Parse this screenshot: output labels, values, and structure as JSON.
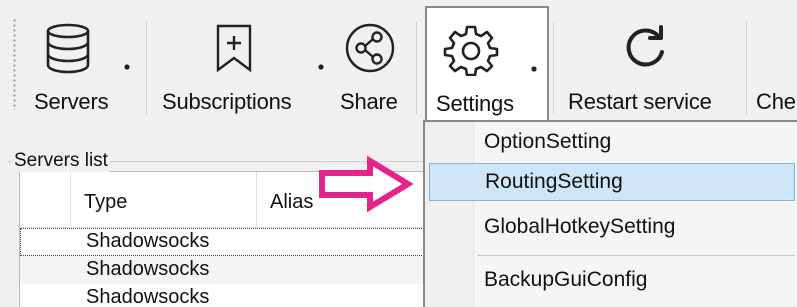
{
  "toolbar": {
    "servers_label": "Servers",
    "subscriptions_label": "Subscriptions",
    "share_label": "Share",
    "settings_label": "Settings",
    "restart_label": "Restart service",
    "check_label": "Che"
  },
  "servers_list": {
    "group_label": "Servers list",
    "columns": [
      "Type",
      "Alias"
    ],
    "rows": [
      {
        "type": "Shadowsocks",
        "alias": ""
      },
      {
        "type": "Shadowsocks",
        "alias": ""
      },
      {
        "type": "Shadowsocks",
        "alias": ""
      }
    ]
  },
  "settings_menu": {
    "items": [
      {
        "label": "OptionSetting"
      },
      {
        "label": "RoutingSetting"
      },
      {
        "label": "GlobalHotkeySetting"
      },
      {
        "label": "BackupGuiConfig"
      }
    ]
  },
  "colors": {
    "menu_hover": "#cde5f7",
    "arrow": "#e6238a"
  },
  "icons": {
    "servers": "database-icon",
    "subscriptions": "bookmark-plus-icon",
    "share": "share-icon",
    "settings": "gear-icon",
    "restart": "refresh-icon"
  }
}
